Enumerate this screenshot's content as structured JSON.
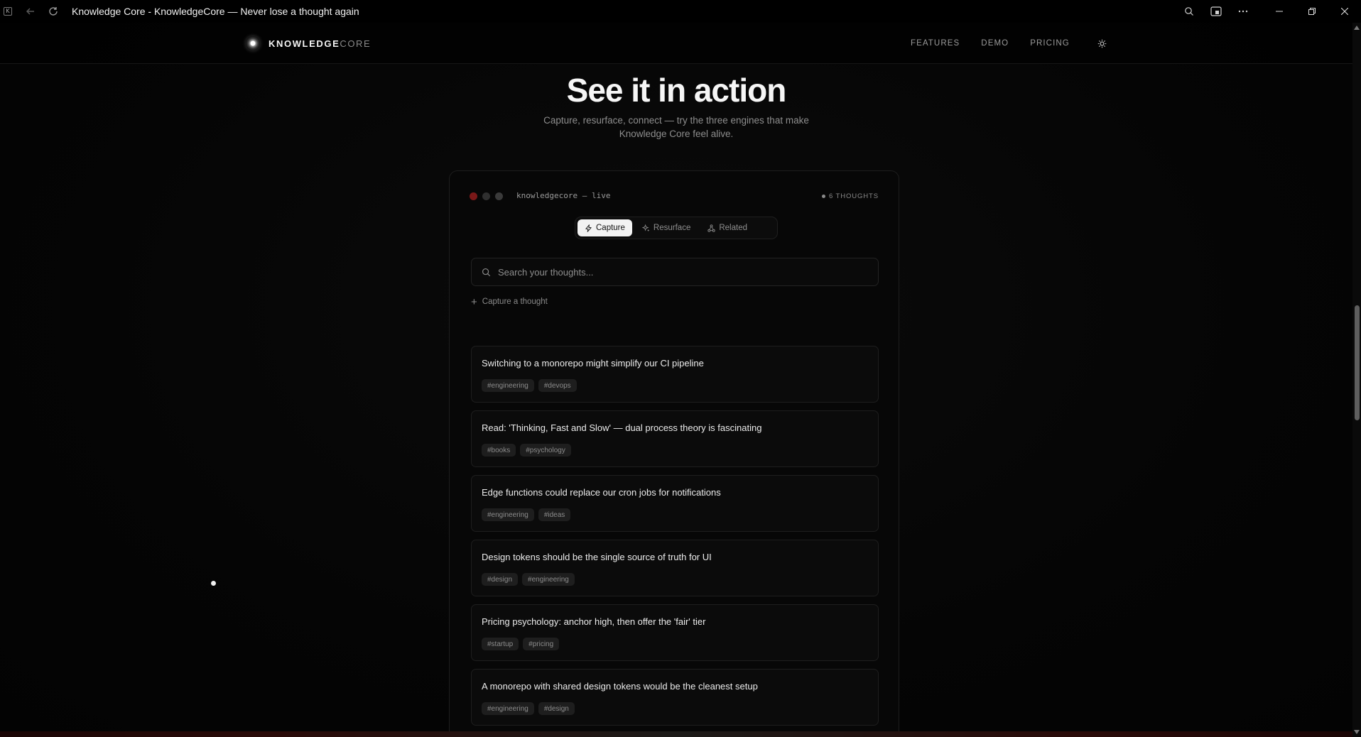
{
  "browser": {
    "tab_title": "Knowledge Core - KnowledgeCore — Never lose a thought again",
    "favicon_letter": "K"
  },
  "nav": {
    "brand_bold": "KNOWLEDGE",
    "brand_light": "CORE",
    "links": [
      "FEATURES",
      "DEMO",
      "PRICING"
    ]
  },
  "hero": {
    "title": "See it in action",
    "subtitle": "Capture, resurface, connect — try the three engines that make Knowledge Core feel alive."
  },
  "demo": {
    "window_label": "knowledgecore — live",
    "thought_count": "6 THOUGHTS",
    "dot_colors": [
      "#7a1818",
      "#2f2f2f",
      "#3a3a3a"
    ],
    "tabs": [
      {
        "label": "Capture",
        "icon": "bolt-icon",
        "active": true
      },
      {
        "label": "Resurface",
        "icon": "sparkle-icon",
        "active": false
      },
      {
        "label": "Related",
        "icon": "graph-icon",
        "active": false
      }
    ],
    "search_placeholder": "Search your thoughts...",
    "capture_label": "Capture a thought",
    "cards": [
      {
        "title": "Switching to a monorepo might simplify our CI pipeline",
        "tags": [
          "#engineering",
          "#devops"
        ]
      },
      {
        "title": "Read: 'Thinking, Fast and Slow' — dual process theory is fascinating",
        "tags": [
          "#books",
          "#psychology"
        ]
      },
      {
        "title": "Edge functions could replace our cron jobs for notifications",
        "tags": [
          "#engineering",
          "#ideas"
        ]
      },
      {
        "title": "Design tokens should be the single source of truth for UI",
        "tags": [
          "#design",
          "#engineering"
        ]
      },
      {
        "title": "Pricing psychology: anchor high, then offer the 'fair' tier",
        "tags": [
          "#startup",
          "#pricing"
        ]
      },
      {
        "title": "A monorepo with shared design tokens would be the cleanest setup",
        "tags": [
          "#engineering",
          "#design"
        ]
      }
    ]
  }
}
